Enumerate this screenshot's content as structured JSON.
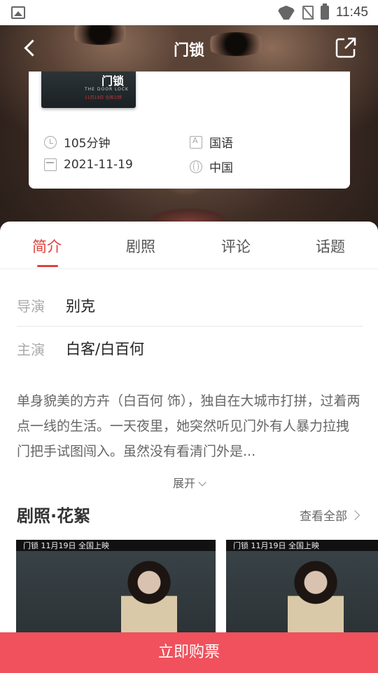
{
  "status_bar": {
    "time": "11:45"
  },
  "nav": {
    "title": "门锁"
  },
  "poster": {
    "title": "门锁",
    "subtitle": "THE DOOR LOCK",
    "release_note": "11月19日 全国上映"
  },
  "meta": {
    "duration": "105分钟",
    "language": "国语",
    "release_date": "2021-11-19",
    "region": "中国"
  },
  "tabs": [
    {
      "label": "简介"
    },
    {
      "label": "剧照"
    },
    {
      "label": "评论"
    },
    {
      "label": "话题"
    }
  ],
  "credits": {
    "director_label": "导演",
    "director": "别克",
    "cast_label": "主演",
    "cast": "白客/白百何"
  },
  "synopsis": "单身貌美的方卉（白百何 饰），独自在大城市打拼，过着两点一线的生活。一天夜里，她突然听见门外有人暴力拉拽门把手试图闯入。虽然没有看清门外是...",
  "expand_label": "展开",
  "stills": {
    "title": "剧照·花絮",
    "view_all": "查看全部",
    "items": [
      {
        "caption": "门锁   11月19日  全国上映"
      },
      {
        "caption": "门锁   11月19日  全国上映"
      }
    ]
  },
  "buy_button": "立即购票"
}
